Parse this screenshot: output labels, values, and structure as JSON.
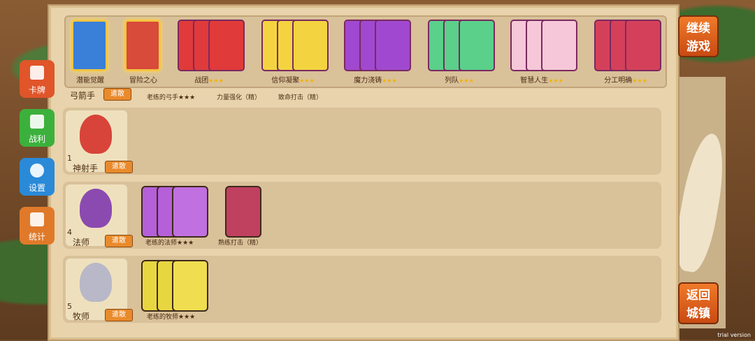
{
  "deck_cards": [
    {
      "label": "潜能觉醒",
      "stars": "",
      "color": "#3a7fd8",
      "selected": true
    },
    {
      "label": "冒险之心",
      "stars": "",
      "color": "#d84a3a",
      "selected": true
    },
    {
      "label": "战团",
      "stars": "★★★",
      "color": "#e03a3a",
      "selected": false
    },
    {
      "label": "信仰凝聚",
      "stars": "★★★",
      "color": "#f3d440",
      "selected": false
    },
    {
      "label": "魔力浇铸",
      "stars": "★★★",
      "color": "#a049d0",
      "selected": false
    },
    {
      "label": "列队",
      "stars": "★★★",
      "color": "#5ad08a",
      "selected": false
    },
    {
      "label": "智慧人生",
      "stars": "★★★",
      "color": "#f6c7d8",
      "selected": false
    },
    {
      "label": "分工明确",
      "stars": "★★★",
      "color": "#d4405a",
      "selected": false
    }
  ],
  "archer_row": {
    "class_name": "弓箭手",
    "dismiss": "遣散",
    "cards": [
      "老练的弓手★★★",
      "力量强化（精）",
      "致命打击（精）"
    ]
  },
  "rows": [
    {
      "count": "1",
      "class_name": "神射手",
      "dismiss": "遣散",
      "avatar_color": "#d8443a",
      "cards": []
    },
    {
      "count": "4",
      "class_name": "法师",
      "dismiss": "遣散",
      "avatar_color": "#8a4ab0",
      "cards": [
        {
          "label": "老练的法师★★★",
          "color": "#b560d8"
        },
        {
          "label": "熟练打击（精）",
          "color": "#c04060"
        }
      ]
    },
    {
      "count": "5",
      "class_name": "牧师",
      "dismiss": "遣散",
      "avatar_color": "#b8b8c8",
      "cards": [
        {
          "label": "老练的牧师★★★",
          "color": "#e8d640"
        }
      ]
    }
  ],
  "side_menu": [
    {
      "label": "卡牌",
      "color": "#e0552a"
    },
    {
      "label": "战利",
      "color": "#3cb03c"
    },
    {
      "label": "设置",
      "color": "#2a8ad8"
    },
    {
      "label": "统计",
      "color": "#e07a2a"
    }
  ],
  "continue_button": "继续\n游戏",
  "continue_l1": "继续",
  "continue_l2": "游戏",
  "return_l1": "返回",
  "return_l2": "城镇",
  "trial": "trial version"
}
